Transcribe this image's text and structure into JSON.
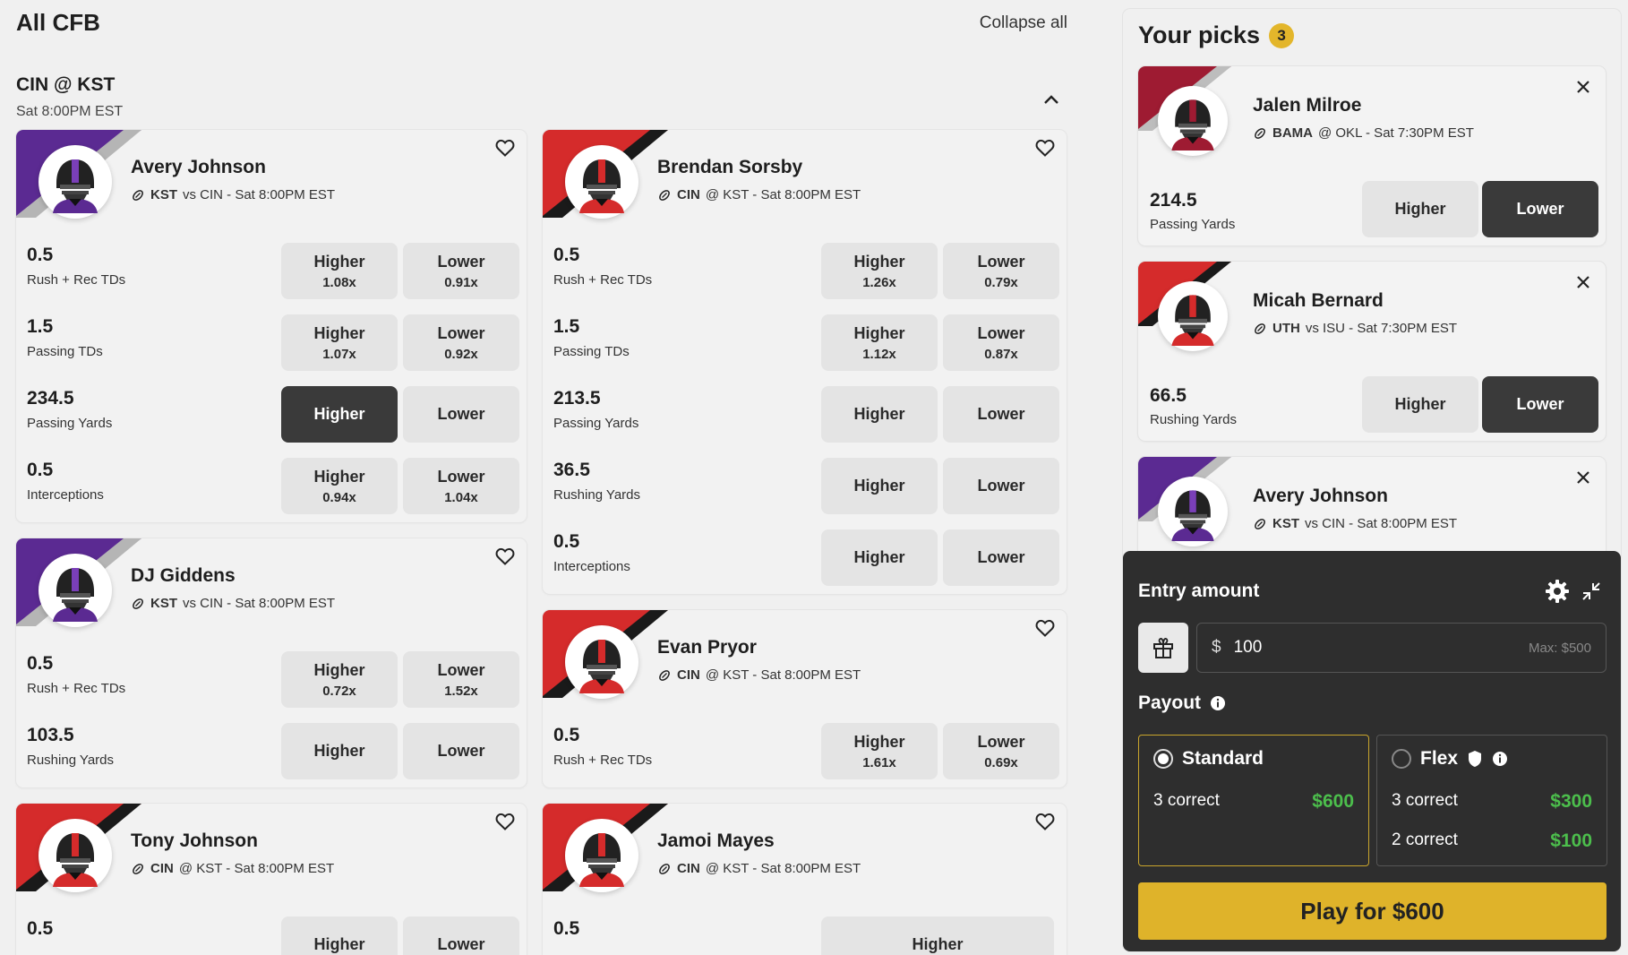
{
  "page": {
    "title": "All CFB",
    "collapse_label": "Collapse all"
  },
  "game": {
    "title": "CIN @ KST",
    "time": "Sat 8:00PM EST"
  },
  "colors": {
    "kst": "#5b2a92",
    "cin": "#d52b2b",
    "bama": "#9e1b32",
    "accent": "#dfb32a",
    "active_btn": "#3a3a3a",
    "payout_green": "#4cbe4c"
  },
  "cards": [
    {
      "name": "Avery Johnson",
      "team": "KST",
      "matchup": "vs CIN - Sat 8:00PM EST",
      "stats": [
        {
          "value": "0.5",
          "label": "Rush + Rec TDs",
          "higher": "Higher",
          "higher_mult": "1.08x",
          "lower": "Lower",
          "lower_mult": "0.91x"
        },
        {
          "value": "1.5",
          "label": "Passing TDs",
          "higher": "Higher",
          "higher_mult": "1.07x",
          "lower": "Lower",
          "lower_mult": "0.92x"
        },
        {
          "value": "234.5",
          "label": "Passing Yards",
          "higher": "Higher",
          "higher_mult": "",
          "lower": "Lower",
          "lower_mult": ""
        },
        {
          "value": "0.5",
          "label": "Interceptions",
          "higher": "Higher",
          "higher_mult": "0.94x",
          "lower": "Lower",
          "lower_mult": "1.04x"
        }
      ]
    },
    {
      "name": "DJ Giddens",
      "team": "KST",
      "matchup": "vs CIN - Sat 8:00PM EST",
      "stats": [
        {
          "value": "0.5",
          "label": "Rush + Rec TDs",
          "higher": "Higher",
          "higher_mult": "0.72x",
          "lower": "Lower",
          "lower_mult": "1.52x"
        },
        {
          "value": "103.5",
          "label": "Rushing Yards",
          "higher": "Higher",
          "higher_mult": "",
          "lower": "Lower",
          "lower_mult": ""
        }
      ]
    },
    {
      "name": "Tony Johnson",
      "team": "CIN",
      "matchup": "@ KST - Sat 8:00PM EST",
      "stats": [
        {
          "value": "0.5",
          "label": "",
          "higher": "Higher",
          "lower": "Lower"
        }
      ]
    },
    {
      "name": "Brendan Sorsby",
      "team": "CIN",
      "matchup": "@ KST - Sat 8:00PM EST",
      "stats": [
        {
          "value": "0.5",
          "label": "Rush + Rec TDs",
          "higher": "Higher",
          "higher_mult": "1.26x",
          "lower": "Lower",
          "lower_mult": "0.79x"
        },
        {
          "value": "1.5",
          "label": "Passing TDs",
          "higher": "Higher",
          "higher_mult": "1.12x",
          "lower": "Lower",
          "lower_mult": "0.87x"
        },
        {
          "value": "213.5",
          "label": "Passing Yards",
          "higher": "Higher",
          "higher_mult": "",
          "lower": "Lower",
          "lower_mult": ""
        },
        {
          "value": "36.5",
          "label": "Rushing Yards",
          "higher": "Higher",
          "higher_mult": "",
          "lower": "Lower",
          "lower_mult": ""
        },
        {
          "value": "0.5",
          "label": "Interceptions",
          "higher": "Higher",
          "higher_mult": "",
          "lower": "Lower",
          "lower_mult": ""
        }
      ]
    },
    {
      "name": "Evan Pryor",
      "team": "CIN",
      "matchup": "@ KST - Sat 8:00PM EST",
      "stats": [
        {
          "value": "0.5",
          "label": "Rush + Rec TDs",
          "higher": "Higher",
          "higher_mult": "1.61x",
          "lower": "Lower",
          "lower_mult": "0.69x"
        }
      ]
    },
    {
      "name": "Jamoi Mayes",
      "team": "CIN",
      "matchup": "@ KST - Sat 8:00PM EST",
      "stats": [
        {
          "value": "0.5",
          "label": "",
          "higher": "Higher"
        }
      ]
    }
  ],
  "picks": {
    "title": "Your picks",
    "count": "3",
    "items": [
      {
        "name": "Jalen Milroe",
        "team": "BAMA",
        "matchup": "@ OKL - Sat 7:30PM EST",
        "value": "214.5",
        "label": "Passing Yards",
        "higher": "Higher",
        "lower": "Lower"
      },
      {
        "name": "Micah Bernard",
        "team": "UTH",
        "matchup": "vs ISU - Sat 7:30PM EST",
        "value": "66.5",
        "label": "Rushing Yards",
        "higher": "Higher",
        "lower": "Lower"
      },
      {
        "name": "Avery Johnson",
        "team": "KST",
        "matchup": "vs CIN - Sat 8:00PM EST"
      }
    ]
  },
  "entry": {
    "title": "Entry amount",
    "currency": "$",
    "amount": "100",
    "max": "Max: $500",
    "payout_title": "Payout",
    "standard": {
      "label": "Standard",
      "line1": "3 correct",
      "amt1": "$600"
    },
    "flex": {
      "label": "Flex",
      "line1": "3 correct",
      "amt1": "$300",
      "line2": "2 correct",
      "amt2": "$100"
    },
    "play_label": "Play for $600"
  }
}
